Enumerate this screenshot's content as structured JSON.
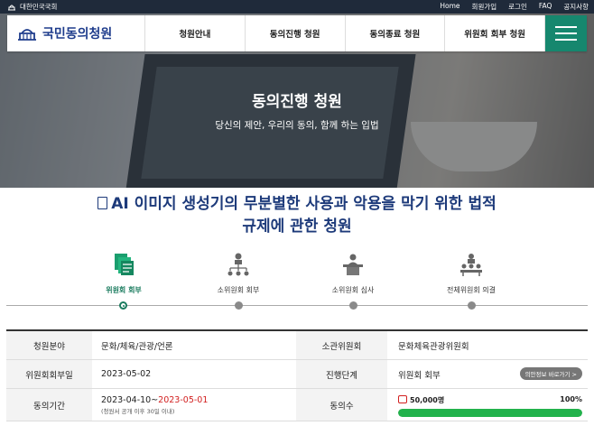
{
  "topbar": {
    "org": "대한민국국회",
    "links": [
      "Home",
      "회원가입",
      "로그인",
      "FAQ",
      "공지사항"
    ]
  },
  "header": {
    "logo": "국민동의청원",
    "nav": [
      "청원안내",
      "동의진행 청원",
      "동의종료 청원",
      "위원회 회부 청원"
    ]
  },
  "hero": {
    "title": "동의진행 청원",
    "subtitle": "당신의 제안, 우리의 동의, 함께 하는 입법"
  },
  "petition": {
    "title_line1": "AI 이미지 생성기의 무분별한 사용과 악용을 막기 위한 법적",
    "title_line2": "규제에 관한 청원"
  },
  "steps": [
    {
      "label": "위원회 회부",
      "icon": "documents-icon",
      "active": true
    },
    {
      "label": "소위원회 회부",
      "icon": "hierarchy-icon",
      "active": false
    },
    {
      "label": "소위원회 심사",
      "icon": "podium-icon",
      "active": false
    },
    {
      "label": "전체위원회 의결",
      "icon": "committee-icon",
      "active": false
    }
  ],
  "info": {
    "field_label": "청원분야",
    "field_value": "문화/체육/관광/언론",
    "committee_label": "소관위원회",
    "committee_value": "문화체육관광위원회",
    "referral_date_label": "위원회회부일",
    "referral_date_value": "2023-05-02",
    "stage_label": "진행단계",
    "stage_value": "위원회 회부",
    "opinion_button": "의안정보 바로가기 >",
    "period_label": "동의기간",
    "period_start": "2023-04-10~",
    "period_end": "2023-05-01",
    "period_note": "(청원서 공개 이후 30일 이내)",
    "count_label": "동의수",
    "count_value": "50,000명",
    "count_percent": "100%",
    "progress": 100
  },
  "colors": {
    "accent": "#16876e",
    "navy": "#1d3a7a",
    "progress": "#22b24c",
    "highlight": "#d21f1f"
  }
}
